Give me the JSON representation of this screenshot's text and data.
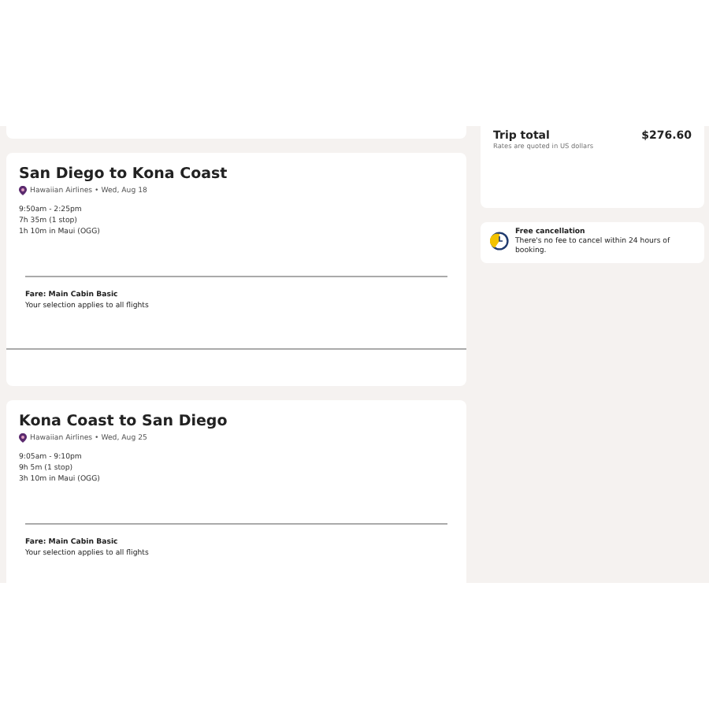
{
  "flights": [
    {
      "title": "San Diego to Kona Coast",
      "airline": "Hawaiian Airlines • Wed, Aug 18",
      "times": "9:50am - 2:25pm",
      "duration": "7h 35m (1 stop)",
      "layover": "1h 10m in Maui (OGG)",
      "fare": "Fare: Main Cabin Basic",
      "note": "Your selection applies to all flights"
    },
    {
      "title": "Kona Coast to San Diego",
      "airline": "Hawaiian Airlines • Wed, Aug 25",
      "times": "9:05am - 9:10pm",
      "duration": "9h 5m (1 stop)",
      "layover": "3h 10m in Maui (OGG)",
      "fare": "Fare: Main Cabin Basic",
      "note": "Your selection applies to all flights"
    }
  ],
  "trip_total": {
    "label": "Trip total",
    "note": "Rates are quoted in US dollars",
    "amount": "$276.60"
  },
  "cancellation": {
    "title": "Free cancellation",
    "text": "There's no fee to cancel within 24 hours of booking."
  }
}
